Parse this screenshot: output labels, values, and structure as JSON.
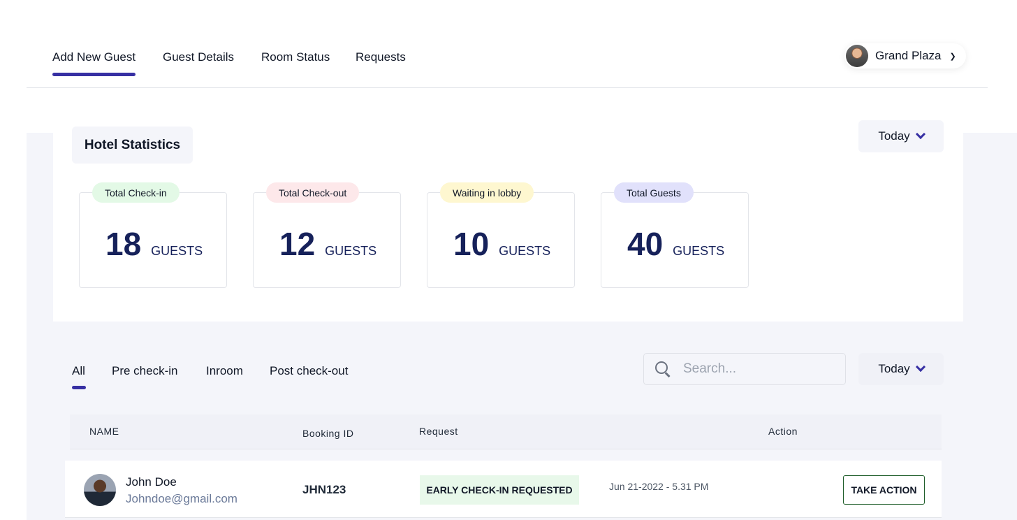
{
  "nav": {
    "tabs": [
      {
        "label": "Add New Guest",
        "active": true
      },
      {
        "label": "Guest Details",
        "active": false
      },
      {
        "label": "Room Status",
        "active": false
      },
      {
        "label": "Requests",
        "active": false
      }
    ],
    "profile": {
      "name": "Grand Plaza"
    }
  },
  "stats": {
    "title": "Hotel Statistics",
    "period": "Today",
    "cards": [
      {
        "label": "Total Check-in",
        "value": "18",
        "unit": "GUESTS",
        "color": "#e3f9e6"
      },
      {
        "label": "Total Check-out",
        "value": "12",
        "unit": "GUESTS",
        "color": "#fde8ea"
      },
      {
        "label": "Waiting in lobby",
        "value": "10",
        "unit": "GUESTS",
        "color": "#fef7d0"
      },
      {
        "label": "Total Guests",
        "value": "40",
        "unit": "GUESTS",
        "color": "#e1e1fb"
      }
    ]
  },
  "filters": {
    "tabs": [
      {
        "label": "All",
        "active": true
      },
      {
        "label": "Pre check-in",
        "active": false
      },
      {
        "label": "Inroom",
        "active": false
      },
      {
        "label": "Post check-out",
        "active": false
      }
    ],
    "search": {
      "placeholder": "Search..."
    },
    "period": "Today"
  },
  "table": {
    "headers": {
      "name": "NAME",
      "booking": "Booking ID",
      "request": "Request",
      "action": "Action"
    },
    "rows": [
      {
        "name": "John Doe",
        "email": "Johndoe@gmail.com",
        "booking_id": "JHN123",
        "request": "EARLY CHECK-IN REQUESTED",
        "date": "Jun 21-2022 - 5.31 PM",
        "action": "TAKE ACTION"
      }
    ]
  },
  "colors": {
    "accent": "#3730a3",
    "stat_number": "#16215a",
    "page_bg": "#f4f5fa"
  }
}
